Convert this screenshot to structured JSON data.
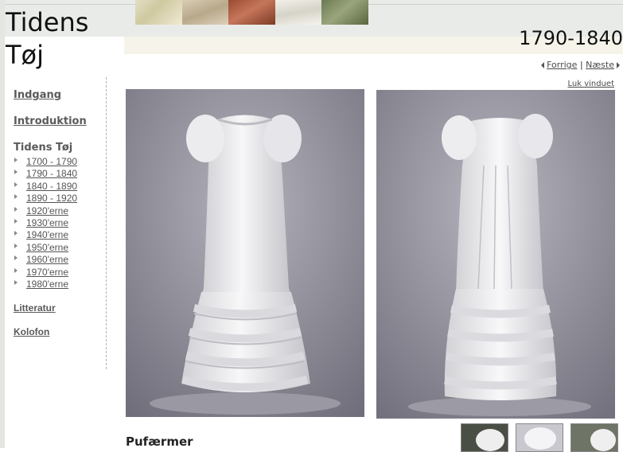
{
  "site": {
    "title_line1": "Tidens",
    "title_line2": "Tøj",
    "period": "1790-1840"
  },
  "pager": {
    "prev": "Forrige",
    "separator": "|",
    "next": "Næste"
  },
  "close_window": "Luk vinduet",
  "nav": {
    "indgang": "Indgang",
    "introduktion": "Introduktion",
    "tidens_toj": "Tidens Tøj",
    "items": [
      {
        "label": "1700 - 1790"
      },
      {
        "label": "1790 - 1840"
      },
      {
        "label": "1840 - 1890"
      },
      {
        "label": "1890 - 1920"
      },
      {
        "label": "1920'erne"
      },
      {
        "label": "1930'erne"
      },
      {
        "label": "1940'erne"
      },
      {
        "label": "1950'erne"
      },
      {
        "label": "1960'erne"
      },
      {
        "label": "1970'erne"
      },
      {
        "label": "1980'erne"
      }
    ],
    "litteratur": "Litteratur",
    "kolofon": "Kolofon"
  },
  "content": {
    "caption": "Pufærmer"
  },
  "colors": {
    "page_bg": "#ffffff",
    "band": "#e9ebe8",
    "photo_bg": "#8f8e99",
    "link": "#555555"
  }
}
